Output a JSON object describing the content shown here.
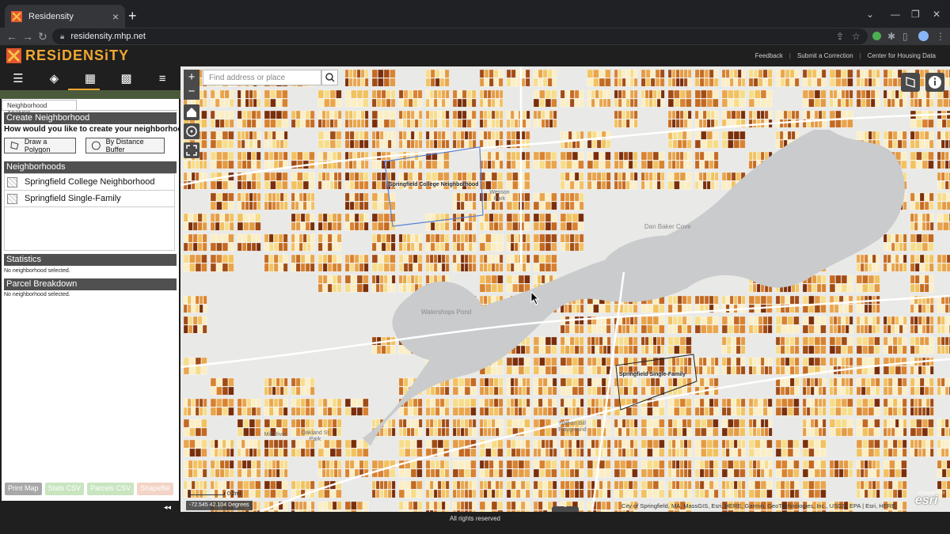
{
  "browser": {
    "tab_title": "Residensity",
    "url": "residensity.mhp.net"
  },
  "app": {
    "logo_text": "RESiDENSiTY",
    "header_links": [
      "Feedback",
      "Submit a Correction",
      "Center for Housing Data"
    ]
  },
  "left_panel": {
    "tab_label": "Neighborhood Analysis",
    "create_heading": "Create Neighborhood",
    "question": "How would you like to create your neighborhood?",
    "draw_polygon_label": "Draw a Polygon",
    "distance_buffer_label": "By Distance Buffer",
    "neighborhoods_heading": "Neighborhoods",
    "neighborhoods": [
      "Springfield College Neighborhood",
      "Springfield Single-Family"
    ],
    "statistics_heading": "Statistics",
    "statistics_note": "No neighborhood selected.",
    "parcel_heading": "Parcel Breakdown",
    "parcel_note": "No neighborhood selected.",
    "bottom_buttons": [
      "Print Map",
      "Stats CSV",
      "Parcels CSV",
      "Shapefile"
    ]
  },
  "map": {
    "search_placeholder": "Find address or place",
    "water_labels": [
      "Watershops Pond",
      "Dan Baker Cove"
    ],
    "park_labels": [
      "Wesson Park",
      "Nathan Bill Playground",
      "Oakland St Park",
      "Mill River"
    ],
    "neighborhood_labels": [
      "Springfield College Neighborhood",
      "Springfield Single-Family"
    ],
    "coordinates": "-72.545 42.104 Degrees",
    "scale": "0.2mi",
    "attribution": "City of Springfield, MA, MassGIS, Esri, HERE, Garmin, GeoTechnologies, Inc., USGS, EPA | Esri, HERE",
    "esri_powered": "POWERED BY",
    "esri_logo": "esri"
  },
  "footer": {
    "text": "All rights reserved"
  },
  "colors": {
    "accent": "#f0a830",
    "dark": "#1f1f1f",
    "parcel_low": "#f7dd8a",
    "parcel_mid": "#e49b45",
    "parcel_high": "#7a2e0b"
  }
}
